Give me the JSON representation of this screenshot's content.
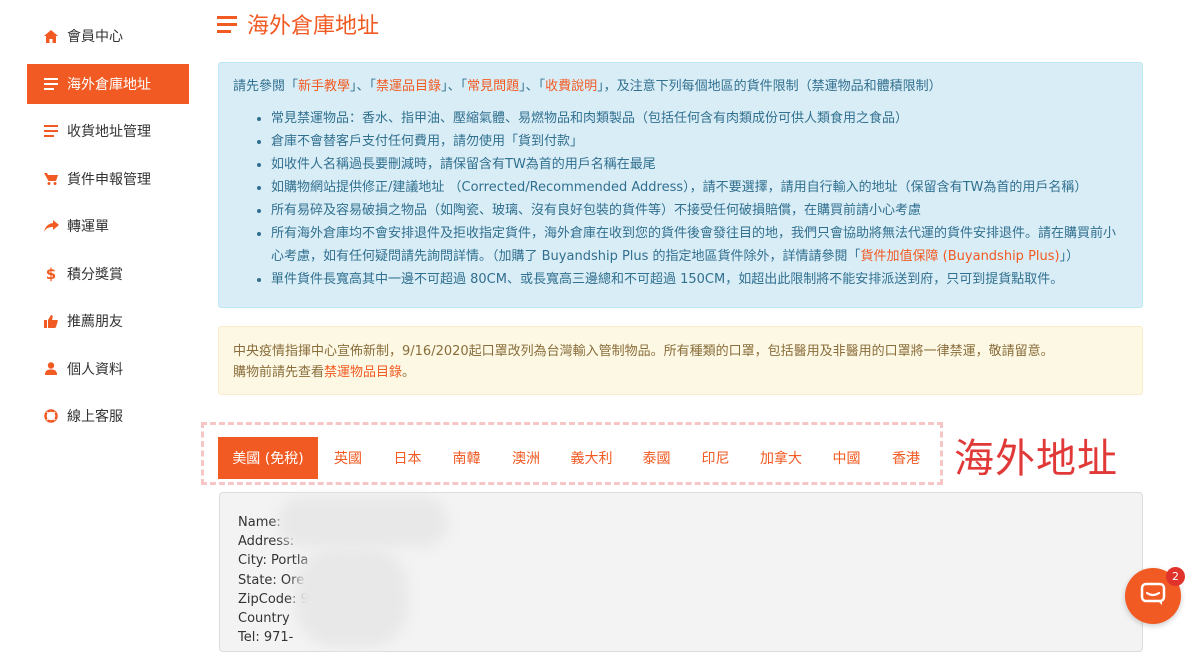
{
  "sidebar": {
    "items": [
      {
        "label": "會員中心",
        "icon": "home-icon"
      },
      {
        "label": "海外倉庫地址",
        "icon": "list-icon",
        "active": true
      },
      {
        "label": "收貨地址管理",
        "icon": "list-icon"
      },
      {
        "label": "貨件申報管理",
        "icon": "cart-icon"
      },
      {
        "label": "轉運單",
        "icon": "share-icon"
      },
      {
        "label": "積分獎賞",
        "icon": "dollar-icon"
      },
      {
        "label": "推薦朋友",
        "icon": "thumbs-up-icon"
      },
      {
        "label": "個人資料",
        "icon": "user-icon"
      },
      {
        "label": "線上客服",
        "icon": "lifebuoy-icon"
      }
    ]
  },
  "page": {
    "title": "海外倉庫地址"
  },
  "info": {
    "intro_prefix": "請先參閱「",
    "link_tutorial": "新手教學",
    "sep1": "」、「",
    "link_banned": "禁運品目錄",
    "sep2": "」、「",
    "link_faq": "常見問題",
    "sep3": "」、「",
    "link_fees": "收費說明",
    "intro_suffix": "」，及注意下列每個地區的貨件限制（禁運物品和體積限制）",
    "bullets": [
      "常見禁運物品：香水、指甲油、壓縮氣體、易燃物品和肉類製品（包括任何含有肉類成份可供人類食用之食品）",
      "倉庫不會替客戶支付任何費用，請勿使用「貨到付款」",
      "如收件人名稱過長要刪減時，請保留含有TW為首的用戶名稱在最尾",
      "如購物網站提供修正/建議地址 （Corrected/Recommended Address），請不要選擇，請用自行輸入的地址（保留含有TW為首的用戶名稱）",
      "所有易碎及容易破損之物品（如陶瓷、玻璃、沒有良好包裝的貨件等）不接受任何破損賠償，在購買前請小心考慮"
    ],
    "bullet6_text": "所有海外倉庫均不會安排退件及拒收指定貨件，海外倉庫在收到您的貨件後會發往目的地，我們只會協助將無法代運的貨件安排退件。請在購買前小心考慮，如有任何疑問請先詢問詳情。（加購了 Buyandship Plus 的指定地區貨件除外，詳情請參閱「",
    "bullet6_link": "貨件加值保障 (Buyandship Plus)",
    "bullet6_end": "」）",
    "bullet7": "單件貨件長寬高其中一邊不可超過 80CM、或長寬高三邊總和不可超過 150CM，如超出此限制將不能安排派送到府，只可到提貨點取件。"
  },
  "warning": {
    "line1": "中央疫情指揮中心宣佈新制，9/16/2020起口罩改列為台灣輸入管制物品。所有種類的口罩，包括醫用及非醫用的口罩將一律禁運，敬請留意。",
    "line2_prefix": "購物前請先查看",
    "line2_link": "禁運物品目錄",
    "line2_suffix": "。"
  },
  "tabs": [
    {
      "label": "美國 (免稅)",
      "active": true
    },
    {
      "label": "英國"
    },
    {
      "label": "日本"
    },
    {
      "label": "南韓"
    },
    {
      "label": "澳洲"
    },
    {
      "label": "義大利"
    },
    {
      "label": "泰國"
    },
    {
      "label": "印尼"
    },
    {
      "label": "加拿大"
    },
    {
      "label": "中國"
    },
    {
      "label": "香港"
    }
  ],
  "annotation": "海外地址",
  "address": {
    "name": "Name:",
    "address": "Address:",
    "city": "City: Portla",
    "state": "State: Ore",
    "zipcode": "ZipCode: 9",
    "country": "Country",
    "tel": "Tel: 971-"
  },
  "chat": {
    "badge": "2"
  },
  "colors": {
    "accent": "#f15a22",
    "info_bg": "#d9edf7",
    "warn_bg": "#fcf8e3",
    "annotation": "#e13838"
  }
}
